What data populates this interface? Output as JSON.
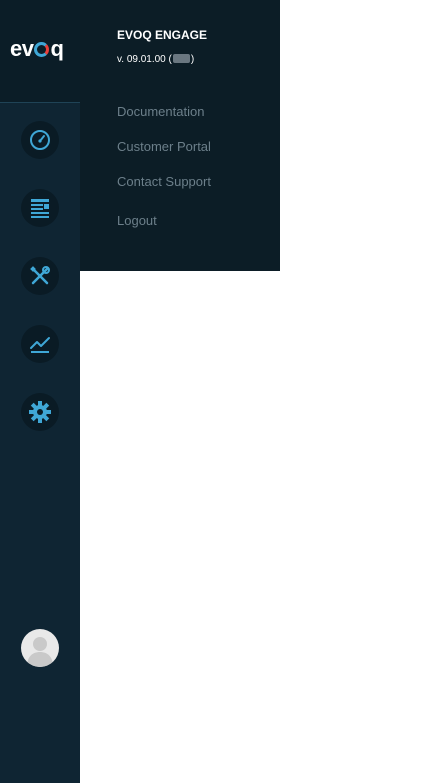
{
  "sidebar": {
    "logo_text_before": "ev",
    "logo_text_after": "q",
    "nav_icons": [
      "dashboard-gauge-icon",
      "content-list-icon",
      "tools-icon",
      "analytics-chart-icon",
      "settings-gear-icon"
    ],
    "accent_color": "#3fa7d6"
  },
  "flyout": {
    "product_name": "EVOQ ENGAGE",
    "version_prefix": "v. 09.01.00 (",
    "version_suffix": ")",
    "links": {
      "documentation": "Documentation",
      "customer_portal": "Customer Portal",
      "contact_support": "Contact Support",
      "logout": "Logout"
    }
  }
}
